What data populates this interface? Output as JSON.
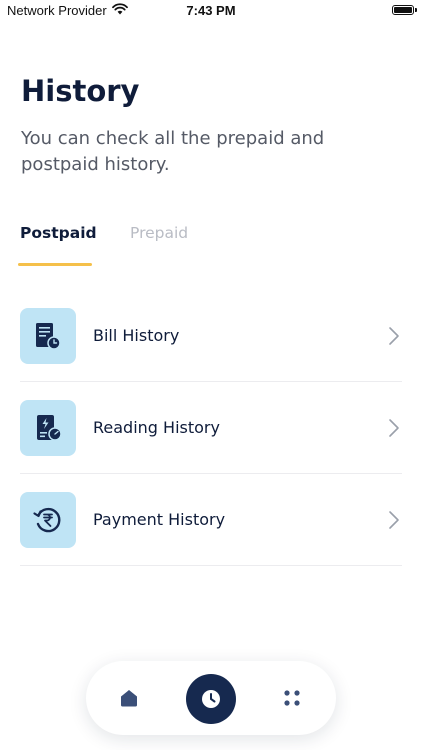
{
  "status_bar": {
    "carrier": "Network Provider",
    "time": "7:43 PM"
  },
  "header": {
    "title": "History",
    "subtitle": "You can check all the prepaid and postpaid history."
  },
  "tabs": [
    {
      "label": "Postpaid",
      "active": true
    },
    {
      "label": "Prepaid",
      "active": false
    }
  ],
  "menu": [
    {
      "label": "Bill History",
      "icon": "bill-clock-icon"
    },
    {
      "label": "Reading History",
      "icon": "meter-reading-icon"
    },
    {
      "label": "Payment History",
      "icon": "rupee-history-icon"
    }
  ],
  "bottom_nav": {
    "items": [
      {
        "icon": "home-icon",
        "active": false
      },
      {
        "icon": "clock-icon",
        "active": true
      },
      {
        "icon": "grid-dots-icon",
        "active": false
      }
    ]
  },
  "colors": {
    "primary": "#16294f",
    "accent_underline": "#f5c04a",
    "icon_tile": "#bfe4f5"
  }
}
